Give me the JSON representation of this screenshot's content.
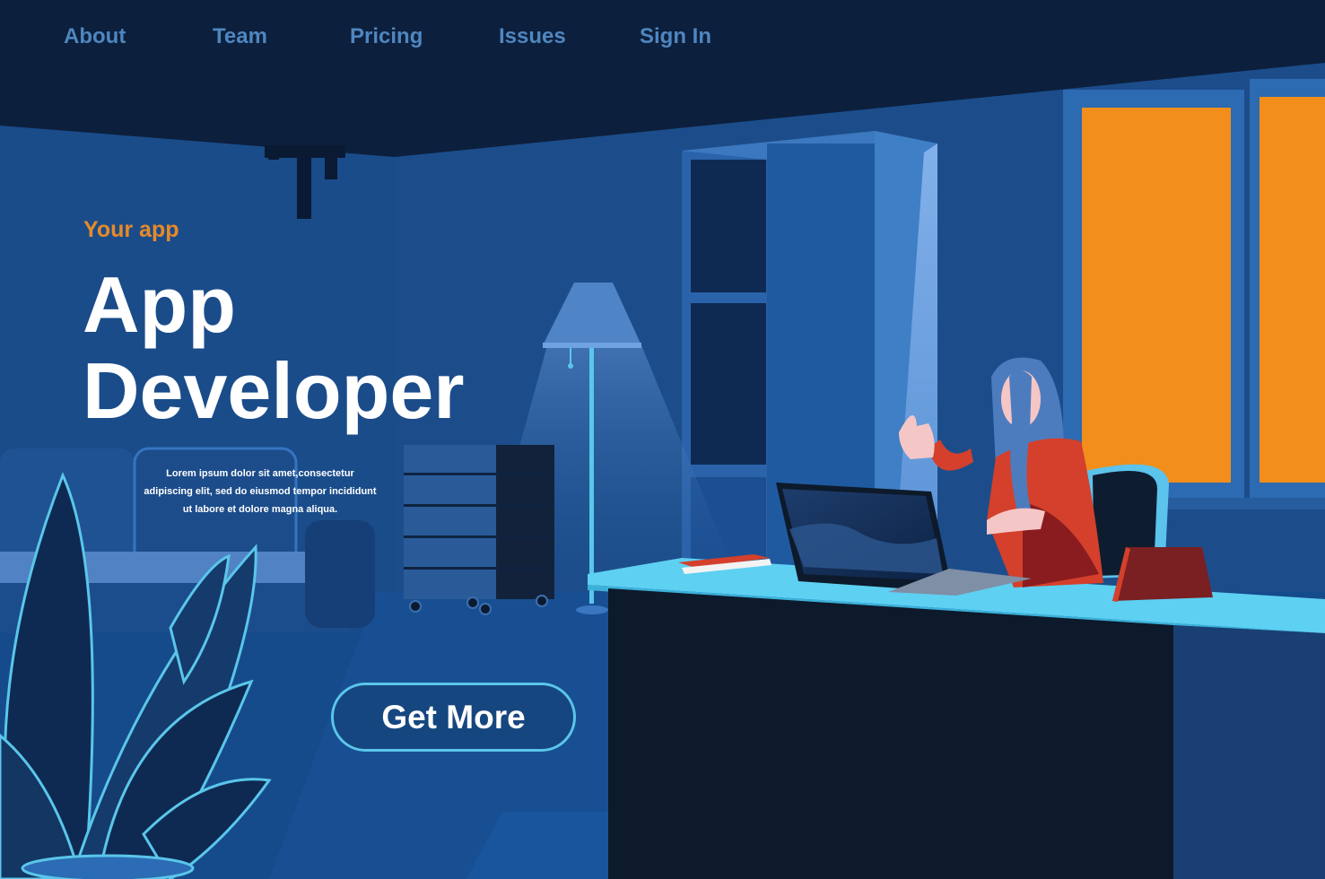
{
  "nav": {
    "items": [
      {
        "label": "About"
      },
      {
        "label": "Team"
      },
      {
        "label": "Pricing"
      },
      {
        "label": "Issues"
      },
      {
        "label": "Sign In"
      }
    ]
  },
  "hero": {
    "eyebrow": "Your app",
    "title_line1": "App",
    "title_line2": "Developer",
    "body_line1": "Lorem ipsum dolor sit amet,consectetur",
    "body_line2": "adipiscing elit, sed do eiusmod tempor incididunt",
    "body_line3": "ut labore et dolore magna aliqua.",
    "cta_label": "Get More"
  },
  "colors": {
    "ceiling": "#0c1f3c",
    "wall": "#1a4a86",
    "floor": "#144a88",
    "nav_text": "#4f86bf",
    "accent_orange": "#e88a28",
    "window_glow": "#f18e1c",
    "cta_border": "#5ac6ea",
    "headline": "#ffffff",
    "person_top": "#d4402b"
  }
}
